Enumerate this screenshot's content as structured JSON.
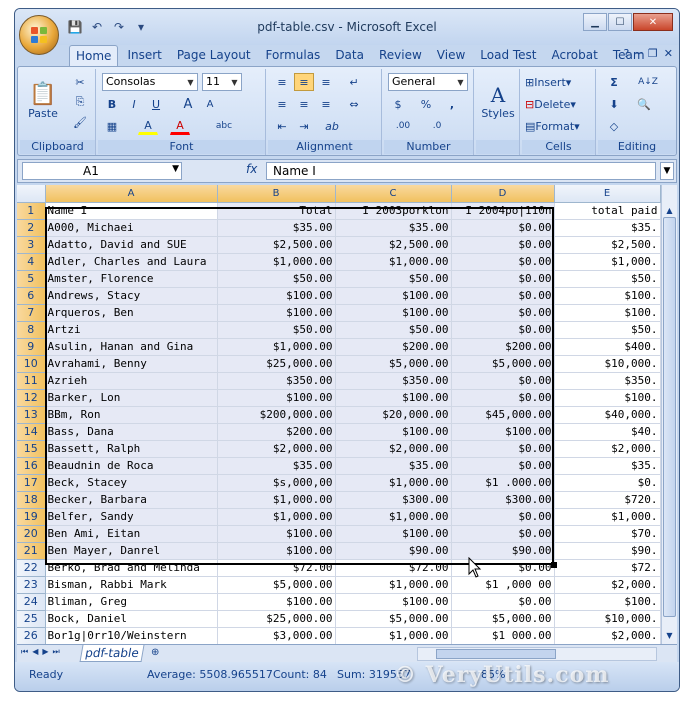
{
  "window": {
    "title": "pdf-table.csv - Microsoft Excel",
    "controls": {
      "minimize": "▁",
      "maximize": "☐",
      "close": "✕"
    }
  },
  "quick_access": {
    "save_icon": "💾",
    "undo_icon": "↶",
    "redo_icon": "↷",
    "more_icon": "▾"
  },
  "ribbon_tabs": [
    {
      "label": "Home",
      "active": true
    },
    {
      "label": "Insert"
    },
    {
      "label": "Page Layout"
    },
    {
      "label": "Formulas"
    },
    {
      "label": "Data"
    },
    {
      "label": "Review"
    },
    {
      "label": "View"
    },
    {
      "label": "Load Test"
    },
    {
      "label": "Acrobat"
    },
    {
      "label": "Team"
    }
  ],
  "ribbon_tab_controls": {
    "help": "?",
    "minimize": "─",
    "restore": "❐",
    "close": "✕"
  },
  "ribbon": {
    "clipboard": {
      "label": "Clipboard",
      "paste": "Paste",
      "cut": "✂",
      "copy": "⎘",
      "format_painter": "🖌"
    },
    "font": {
      "label": "Font",
      "name": "Consolas",
      "size": "11",
      "bold": "B",
      "italic": "I",
      "underline": "U",
      "grow": "A",
      "shrink": "A",
      "borders": "▦",
      "fill": "A",
      "color": "A",
      "phonetic": "abc"
    },
    "alignment": {
      "label": "Alignment",
      "top": "≡",
      "middle": "≡",
      "bottom": "≡",
      "wrap": "↵",
      "left": "≡",
      "center": "≡",
      "right": "≡",
      "merge": "⇔",
      "indent_dec": "⇤",
      "indent_inc": "⇥",
      "orientation": "ab"
    },
    "number": {
      "label": "Number",
      "format": "General",
      "currency": "$",
      "percent": "%",
      "comma": ",",
      "inc_dec": ".00",
      "dec_dec": ".0"
    },
    "styles": {
      "label": "Styles",
      "name": "Styles"
    },
    "cells": {
      "label": "Cells",
      "insert": "Insert",
      "delete": "Delete",
      "format": "Format"
    },
    "editing": {
      "label": "Editing",
      "sum": "Σ",
      "sort": "A↓Z",
      "fill": "⬇",
      "find": "🔍",
      "clear": "◇"
    }
  },
  "formula_bar": {
    "name_box": "A1",
    "fx": "fx",
    "formula": "Name I"
  },
  "columns": [
    "A",
    "B",
    "C",
    "D",
    "E"
  ],
  "rows": [
    {
      "n": "1",
      "cells": [
        "Name I",
        "Total",
        "I 2003porklon",
        "I 2004po|110n",
        "total paid"
      ]
    },
    {
      "n": "2",
      "cells": [
        "A000, Michaei",
        "$35.00",
        "$35.00",
        "$0.00",
        "$35."
      ]
    },
    {
      "n": "3",
      "cells": [
        "Adatto, David and SUE",
        "$2,500.00",
        "$2,500.00",
        "$0.00",
        "$2,500."
      ]
    },
    {
      "n": "4",
      "cells": [
        "Adler, Charles and Laura",
        "$1,000.00",
        "$1,000.00",
        "$0.00",
        "$1,000."
      ]
    },
    {
      "n": "5",
      "cells": [
        "Amster, Florence",
        "$50.00",
        "$50.00",
        "$0.00",
        "$50."
      ]
    },
    {
      "n": "6",
      "cells": [
        "Andrews, Stacy",
        "$100.00",
        "$100.00",
        "$0.00",
        "$100."
      ]
    },
    {
      "n": "7",
      "cells": [
        "Arqueros, Ben",
        "$100.00",
        "$100.00",
        "$0.00",
        "$100."
      ]
    },
    {
      "n": "8",
      "cells": [
        "Artzi",
        "$50.00",
        "$50.00",
        "$0.00",
        "$50."
      ]
    },
    {
      "n": "9",
      "cells": [
        "Asulin, Hanan and Gina",
        "$1,000.00",
        "$200.00",
        "$200.00",
        "$400."
      ]
    },
    {
      "n": "10",
      "cells": [
        "Avrahami, Benny",
        "$25,000.00",
        "$5,000.00",
        "$5,000.00",
        "$10,000."
      ]
    },
    {
      "n": "11",
      "cells": [
        "Azrieh",
        "$350.00",
        "$350.00",
        "$0.00",
        "$350."
      ]
    },
    {
      "n": "12",
      "cells": [
        "Barker, Lon",
        "$100.00",
        "$100.00",
        "$0.00",
        "$100."
      ]
    },
    {
      "n": "13",
      "cells": [
        "BBm, Ron",
        "$200,000.00",
        "$20,000.00",
        "$45,000.00",
        "$40,000."
      ]
    },
    {
      "n": "14",
      "cells": [
        "Bass, Dana",
        "$200.00",
        "$100.00",
        "$100.00",
        "$40."
      ]
    },
    {
      "n": "15",
      "cells": [
        "Bassett, Ralph",
        "$2,000.00",
        "$2,000.00",
        "$0.00",
        "$2,000."
      ]
    },
    {
      "n": "16",
      "cells": [
        "Beaudnin de Roca",
        "$35.00",
        "$35.00",
        "$0.00",
        "$35."
      ]
    },
    {
      "n": "17",
      "cells": [
        "Beck, Stacey",
        "$s,000,00",
        "$1,000.00",
        "$1 .000.00",
        "$0."
      ]
    },
    {
      "n": "18",
      "cells": [
        "Becker, Barbara",
        "$1,000.00",
        "$300.00",
        "$300.00",
        "$720."
      ]
    },
    {
      "n": "19",
      "cells": [
        "Belfer, Sandy",
        "$1,000.00",
        "$1,000.00",
        "$0.00",
        "$1,000."
      ]
    },
    {
      "n": "20",
      "cells": [
        "Ben Ami, Eitan",
        "$100.00",
        "$100.00",
        "$0.00",
        "$70."
      ]
    },
    {
      "n": "21",
      "cells": [
        "Ben Mayer, Danrel",
        "$100.00",
        "$90.00",
        "$90.00",
        "$90."
      ]
    },
    {
      "n": "22",
      "cells": [
        "Berko, Brad and Melinda",
        "$72.00",
        "$72.00",
        "$0.00",
        "$72."
      ]
    },
    {
      "n": "23",
      "cells": [
        "Bisman, Rabbi Mark",
        "$5,000.00",
        "$1,000.00",
        "$1 ,000 00",
        "$2,000."
      ]
    },
    {
      "n": "24",
      "cells": [
        "Bliman, Greg",
        "$100.00",
        "$100.00",
        "$0.00",
        "$100."
      ]
    },
    {
      "n": "25",
      "cells": [
        "Bock, Daniel",
        "$25,000.00",
        "$5,000.00",
        "$5,000.00",
        "$10,000."
      ]
    },
    {
      "n": "26",
      "cells": [
        "Bor1g|0rr10/Weinstern",
        "$3,000.00",
        "$1,000.00",
        "$1 000.00",
        "$2,000."
      ]
    }
  ],
  "sheet_tab": "pdf-table",
  "status": {
    "mode": "Ready",
    "average": "Average: 5508.965517",
    "count": "Count: 84",
    "sum": "Sum: 319557",
    "zoom": "85%"
  },
  "watermark": "© VeryUtils.com"
}
